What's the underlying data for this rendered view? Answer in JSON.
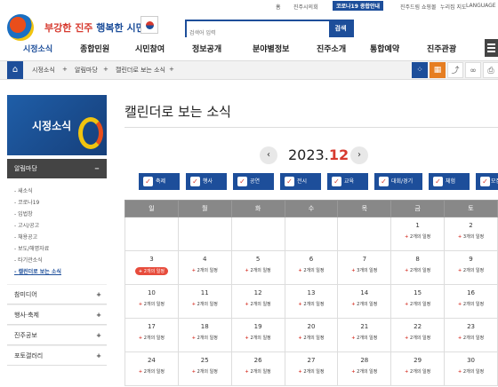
{
  "topbar": {
    "links": [
      "홈",
      "진주시의회",
      "코로나19 종합안내",
      "진주드림 쇼핑몰",
      "누리집 지도",
      "LANGUAGE"
    ]
  },
  "header": {
    "slogan_a": "부강한 진주",
    "slogan_b": "행복한 시민",
    "search_placeholder": "검색어 입력",
    "search_button": "검색"
  },
  "gnb": [
    "시정소식",
    "종합민원",
    "시민참여",
    "정보공개",
    "분야별정보",
    "진주소개",
    "통합예약",
    "진주관광"
  ],
  "breadcrumb": [
    "시정소식",
    "알림마당",
    "캘린더로 보는 소식"
  ],
  "sidebar": {
    "banner_title": "시정소식",
    "section": "알림마당",
    "sub_items": [
      "새소식",
      "코로나19",
      "입법창",
      "고시/공고",
      "채용공고",
      "보도/해명자료",
      "타기관소식",
      "캘린더로 보는 소식"
    ],
    "current_index": 7,
    "items": [
      "참미디어",
      "행사·축제",
      "진주공보",
      "포토갤러리"
    ]
  },
  "main": {
    "title": "캘린더로 보는 소식",
    "year_label": "2023.",
    "month_label": "12",
    "filters": [
      "축제",
      "행사",
      "공연",
      "전시",
      "교육",
      "대회/경기",
      "체험",
      "모집"
    ]
  },
  "calendar": {
    "weekdays": [
      "일",
      "월",
      "화",
      "수",
      "목",
      "금",
      "토"
    ],
    "weeks": [
      [
        {
          "d": "",
          "n": ""
        },
        {
          "d": "",
          "n": ""
        },
        {
          "d": "",
          "n": ""
        },
        {
          "d": "",
          "n": ""
        },
        {
          "d": "",
          "n": ""
        },
        {
          "d": "1",
          "n": "2개의 일정"
        },
        {
          "d": "2",
          "n": "3개의 일정"
        }
      ],
      [
        {
          "d": "3",
          "n": "2개의 일정",
          "hl": true
        },
        {
          "d": "4",
          "n": "2개의 일정"
        },
        {
          "d": "5",
          "n": "2개의 일정"
        },
        {
          "d": "6",
          "n": "2개의 일정"
        },
        {
          "d": "7",
          "n": "3개의 일정"
        },
        {
          "d": "8",
          "n": "2개의 일정"
        },
        {
          "d": "9",
          "n": "2개의 일정"
        }
      ],
      [
        {
          "d": "10",
          "n": "2개의 일정"
        },
        {
          "d": "11",
          "n": "2개의 일정"
        },
        {
          "d": "12",
          "n": "2개의 일정"
        },
        {
          "d": "13",
          "n": "2개의 일정"
        },
        {
          "d": "14",
          "n": "2개의 일정"
        },
        {
          "d": "15",
          "n": "2개의 일정"
        },
        {
          "d": "16",
          "n": "2개의 일정"
        }
      ],
      [
        {
          "d": "17",
          "n": "2개의 일정"
        },
        {
          "d": "18",
          "n": "2개의 일정"
        },
        {
          "d": "19",
          "n": "2개의 일정"
        },
        {
          "d": "20",
          "n": "2개의 일정"
        },
        {
          "d": "21",
          "n": "2개의 일정"
        },
        {
          "d": "22",
          "n": "2개의 일정"
        },
        {
          "d": "23",
          "n": "2개의 일정"
        }
      ],
      [
        {
          "d": "24",
          "n": "2개의 일정"
        },
        {
          "d": "25",
          "n": "2개의 일정"
        },
        {
          "d": "26",
          "n": "2개의 일정"
        },
        {
          "d": "27",
          "n": "2개의 일정"
        },
        {
          "d": "28",
          "n": "2개의 일정"
        },
        {
          "d": "29",
          "n": "2개의 일정"
        },
        {
          "d": "30",
          "n": "2개의 일정"
        }
      ]
    ]
  }
}
